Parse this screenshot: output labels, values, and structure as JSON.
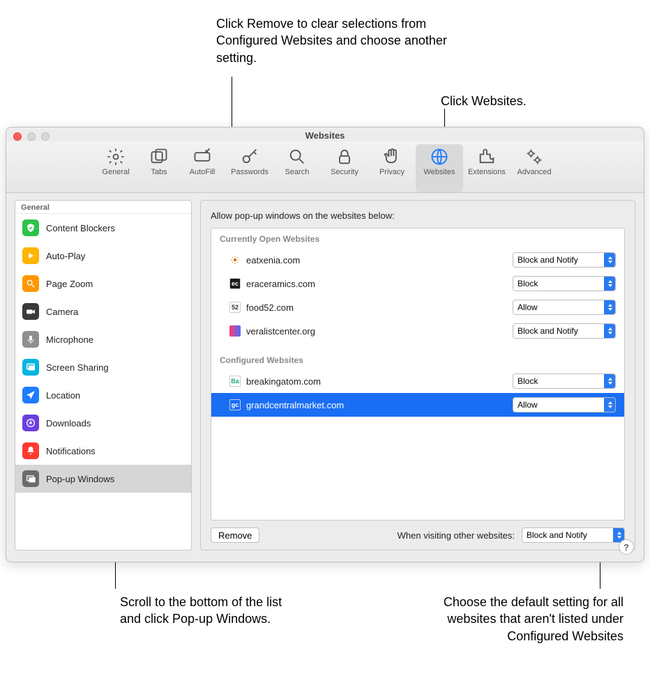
{
  "callouts": {
    "top_left": "Click Remove to clear selections from Configured Websites and choose another setting.",
    "top_right": "Click Websites.",
    "bottom_left": "Scroll to the bottom of the list and click Pop-up Windows.",
    "bottom_right": "Choose the default setting for all websites that aren't listed under Configured Websites"
  },
  "window_title": "Websites",
  "toolbar": {
    "items": [
      {
        "label": "General",
        "icon": "gear"
      },
      {
        "label": "Tabs",
        "icon": "tabs"
      },
      {
        "label": "AutoFill",
        "icon": "autofill"
      },
      {
        "label": "Passwords",
        "icon": "key"
      },
      {
        "label": "Search",
        "icon": "search"
      },
      {
        "label": "Security",
        "icon": "lock"
      },
      {
        "label": "Privacy",
        "icon": "hand"
      },
      {
        "label": "Websites",
        "icon": "globe",
        "selected": true
      },
      {
        "label": "Extensions",
        "icon": "puzzle"
      },
      {
        "label": "Advanced",
        "icon": "gears"
      }
    ]
  },
  "sidebar": {
    "header": "General",
    "items": [
      {
        "label": "Content Blockers",
        "icon": "shield",
        "color": "#2fc24a"
      },
      {
        "label": "Auto-Play",
        "icon": "play",
        "color": "#ffb400"
      },
      {
        "label": "Page Zoom",
        "icon": "zoom",
        "color": "#ff9700"
      },
      {
        "label": "Camera",
        "icon": "camera",
        "color": "#3a3a3a"
      },
      {
        "label": "Microphone",
        "icon": "mic",
        "color": "#8e8e8e"
      },
      {
        "label": "Screen Sharing",
        "icon": "screen",
        "color": "#06b4e0"
      },
      {
        "label": "Location",
        "icon": "arrow",
        "color": "#1d7bff"
      },
      {
        "label": "Downloads",
        "icon": "download",
        "color": "#6b3fe0"
      },
      {
        "label": "Notifications",
        "icon": "bell",
        "color": "#ff3b30"
      },
      {
        "label": "Pop-up Windows",
        "icon": "popup",
        "color": "#6b6b6b",
        "selected": true
      }
    ]
  },
  "main": {
    "heading": "Allow pop-up windows on the websites below:",
    "sections": [
      {
        "title": "Currently Open Websites",
        "rows": [
          {
            "site": "eatxenia.com",
            "action": "Block and Notify",
            "fav": "sun",
            "favbg": "#fff"
          },
          {
            "site": "eraceramics.com",
            "action": "Block",
            "fav": "ec",
            "favbg": "#1a1a1a",
            "favfg": "#fff"
          },
          {
            "site": "food52.com",
            "action": "Allow",
            "fav": "52",
            "favbg": "#fff",
            "favfg": "#333"
          },
          {
            "site": "veralistcenter.org",
            "action": "Block and Notify",
            "fav": "grad",
            "favbg": "grad"
          }
        ]
      },
      {
        "title": "Configured Websites",
        "rows": [
          {
            "site": "breakingatom.com",
            "action": "Block",
            "fav": "Ba",
            "favbg": "#fff",
            "favfg": "#2a8"
          },
          {
            "site": "grandcentralmarket.com",
            "action": "Allow",
            "fav": "gc",
            "favbg": "#1a6ef4",
            "favfg": "#fff",
            "selected": true
          }
        ]
      }
    ],
    "remove_label": "Remove",
    "default_label": "When visiting other websites:",
    "default_value": "Block and Notify"
  }
}
